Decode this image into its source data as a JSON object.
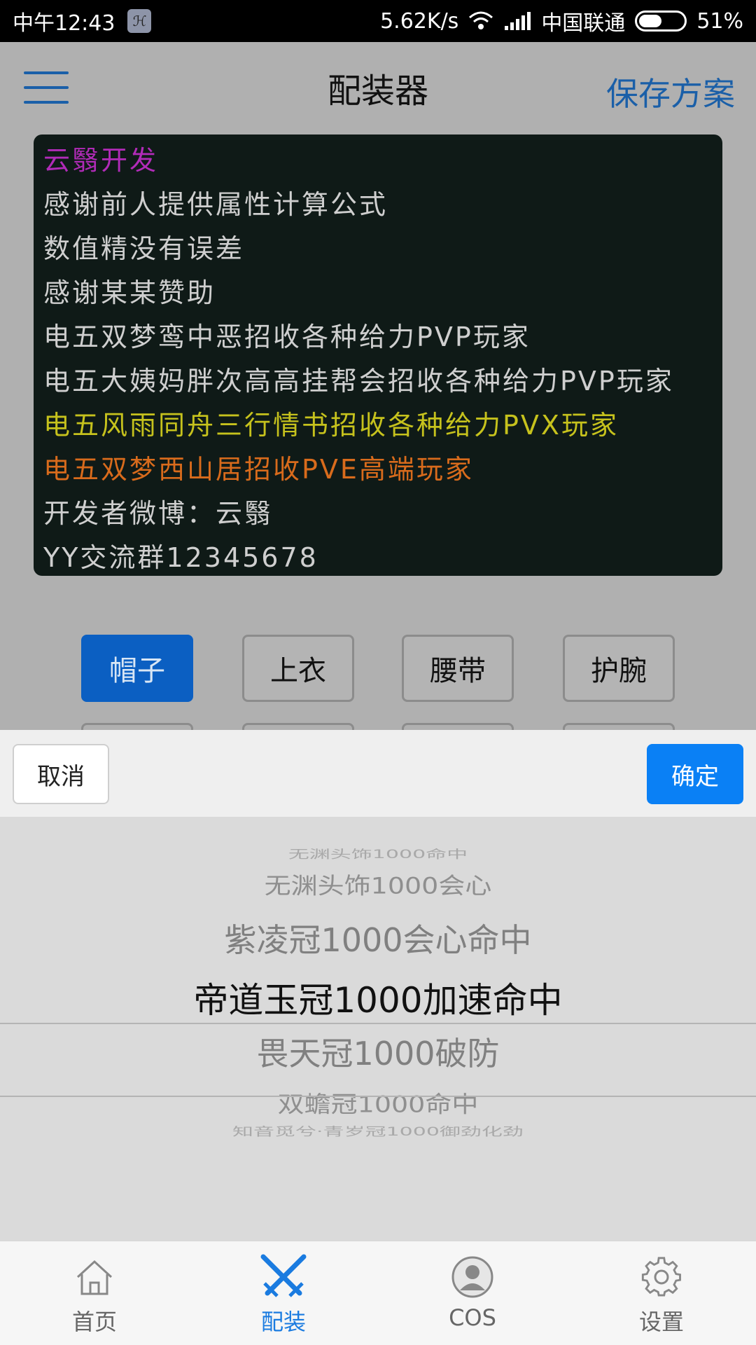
{
  "status_bar": {
    "time": "中午12:43",
    "app_badge": "ℋ",
    "net_speed": "5.62K/s",
    "carrier": "中国联通",
    "battery": "51%",
    "battery_level": 0.51
  },
  "header": {
    "title": "配装器",
    "save_label": "保存方案"
  },
  "info_panel": {
    "lines": [
      {
        "text": "云翳开发",
        "color": "#b12bb8"
      },
      {
        "text": "感谢前人提供属性计算公式",
        "color": "#cfcfcf"
      },
      {
        "text": "数值精没有误差",
        "color": "#cfcfcf"
      },
      {
        "text": "感谢某某赞助",
        "color": "#cfcfcf"
      },
      {
        "text": "电五双梦鸾中恶招收各种给力PVP玩家",
        "color": "#cfcfcf"
      },
      {
        "text": "电五大姨妈胖次高高挂帮会招收各种给力PVP玩家",
        "color": "#cfcfcf"
      },
      {
        "text": "电五风雨同舟三行情书招收各种给力PVX玩家",
        "color": "#c6c21d"
      },
      {
        "text": "电五双梦西山居招收PVE高端玩家",
        "color": "#d86b1c"
      },
      {
        "text": "开发者微博：云翳",
        "color": "#cfcfcf"
      },
      {
        "text": "YY交流群12345678",
        "color": "#cfcfcf"
      }
    ]
  },
  "equipment_tabs": [
    {
      "label": "帽子",
      "active": true
    },
    {
      "label": "上衣",
      "active": false
    },
    {
      "label": "腰带",
      "active": false
    },
    {
      "label": "护腕",
      "active": false
    }
  ],
  "picker": {
    "cancel_label": "取消",
    "confirm_label": "确定",
    "items": [
      "无渊头饰1000命中",
      "无渊头饰1000会心",
      "紫凌冠1000会心命中",
      "帝道玉冠1000加速命中",
      "畏天冠1000破防",
      "双蟾冠1000命中",
      "知音觅兮·青岁冠1000御劲化劲"
    ],
    "selected_index": 3
  },
  "bottom_nav": [
    {
      "label": "首页",
      "icon": "home-icon",
      "active": false
    },
    {
      "label": "配装",
      "icon": "crossed-swords-icon",
      "active": true
    },
    {
      "label": "COS",
      "icon": "profile-icon",
      "active": false
    },
    {
      "label": "设置",
      "icon": "gear-icon",
      "active": false
    }
  ],
  "colors": {
    "accent": "#0a80f5",
    "active_tab": "#0b5fc2",
    "title_link": "#1a5fa8",
    "nav_active": "#1a7be0"
  }
}
